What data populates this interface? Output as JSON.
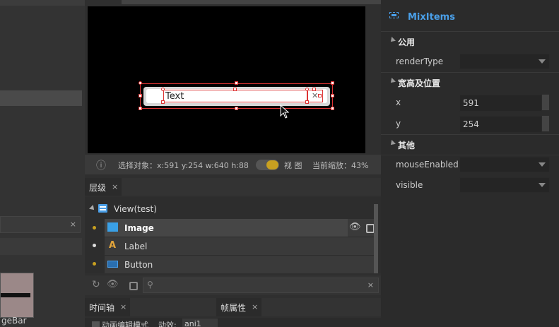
{
  "left_panel": {
    "search_clear": "×",
    "thumb_label": "geBar"
  },
  "stage": {
    "widget_text": "Text"
  },
  "status_bar": {
    "info_icon": "ⓘ",
    "selection_text": "选择对象：x:591 y:254  w:640 h:88",
    "view_label": "视 图",
    "zoom_text": "当前缩放：43%"
  },
  "layers": {
    "tab_label": "层级",
    "tab_close": "×",
    "root": "View(test)",
    "items": [
      {
        "label": "Image",
        "icon": "image-icon",
        "dot": "#c8a020"
      },
      {
        "label": "Label",
        "icon": "label-icon",
        "dot": "#dcdcdc"
      },
      {
        "label": "Button",
        "icon": "button-icon",
        "dot": "#c8a020"
      }
    ],
    "filter_clear": "×"
  },
  "bottom_tabs": [
    {
      "label": "时间轴",
      "close": "×"
    },
    {
      "label": "帧属性",
      "close": "×"
    }
  ],
  "timeline": {
    "mode_label": "动画编辑模式",
    "anim_label": "动效:",
    "anim_value": "ani1"
  },
  "properties": {
    "component_name": "MixItems",
    "sections": {
      "common": "公用",
      "size_pos": "宽高及位置",
      "other": "其他"
    },
    "render_type_label": "renderType",
    "x_label": "x",
    "x_value": "591",
    "y_label": "y",
    "y_value": "254",
    "mouse_enabled_label": "mouseEnabled",
    "visible_label": "visible"
  },
  "colors": {
    "accent": "#4a9fe8",
    "selection": "#d33333",
    "toggle": "#c8a020"
  }
}
